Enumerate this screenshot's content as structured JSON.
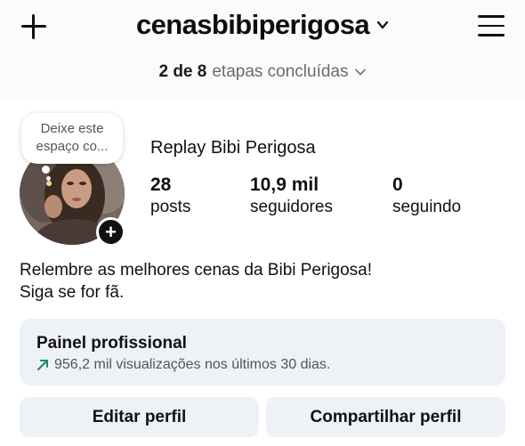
{
  "header": {
    "username": "cenasbibiperigosa",
    "steps_count": "2 de 8",
    "steps_text": "etapas concluídas"
  },
  "profile": {
    "note_line1": "Deixe este",
    "note_line2": "espaço co...",
    "display_name": "Replay Bibi Perigosa",
    "stats": [
      {
        "value": "28",
        "label": "posts"
      },
      {
        "value": "10,9 mil",
        "label": "seguidores"
      },
      {
        "value": "0",
        "label": "seguindo"
      }
    ],
    "bio_line1": "Relembre as melhores cenas da Bibi Perigosa!",
    "bio_line2": "Siga se for fã."
  },
  "pro_panel": {
    "title": "Painel profissional",
    "subtitle": "956,2 mil visualizações nos últimos 30 dias."
  },
  "buttons": {
    "edit": "Editar perfil",
    "share": "Compartilhar perfil"
  },
  "colors": {
    "accent_trend": "#1b8a6b",
    "panel_bg": "#eef1f5",
    "muted_text": "#6b6b6b"
  },
  "icons": [
    "plus-icon",
    "chevron-down-icon",
    "hamburger-menu-icon",
    "add-story-icon",
    "trend-up-icon"
  ]
}
